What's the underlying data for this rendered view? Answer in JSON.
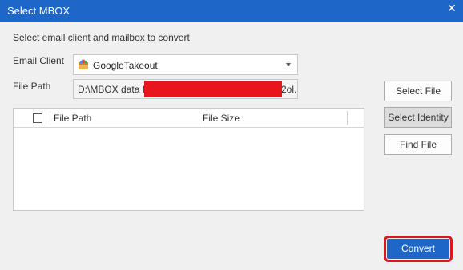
{
  "window": {
    "title": "Select MBOX",
    "close_label": "✕"
  },
  "instruction": "Select email client and mailbox to convert",
  "email_client": {
    "label": "Email Client",
    "selected": "GoogleTakeout",
    "icon": "google-takeout-icon"
  },
  "file_path": {
    "label": "File Path",
    "value_start": "D:\\MBOX data file",
    "value_end": "2ol.("
  },
  "table": {
    "columns": [
      "File Path",
      "File Size"
    ],
    "rows": []
  },
  "buttons": {
    "select_file": "Select File",
    "select_identity": "Select Identity",
    "find_file": "Find File",
    "convert": "Convert"
  },
  "colors": {
    "title_bar": "#1f66c9",
    "convert_button": "#1f66c9",
    "highlight_ring": "#e0141e",
    "redaction": "#e8141e"
  }
}
